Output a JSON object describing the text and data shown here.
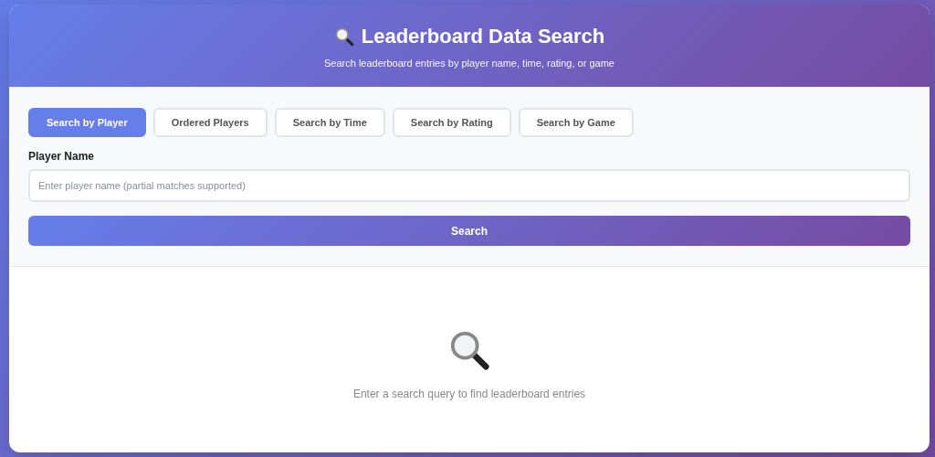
{
  "header": {
    "title": "Leaderboard Data Search",
    "subtitle": "Search leaderboard entries by player name, time, rating, or game"
  },
  "tabs": [
    {
      "label": "Search by Player",
      "selected": true
    },
    {
      "label": "Ordered Players",
      "selected": false
    },
    {
      "label": "Search by Time",
      "selected": false
    },
    {
      "label": "Search by Rating",
      "selected": false
    },
    {
      "label": "Search by Game",
      "selected": false
    }
  ],
  "form": {
    "label": "Player Name",
    "placeholder": "Enter player name (partial matches supported)",
    "button": "Search"
  },
  "empty_state": {
    "message": "Enter a search query to find leaderboard entries"
  }
}
